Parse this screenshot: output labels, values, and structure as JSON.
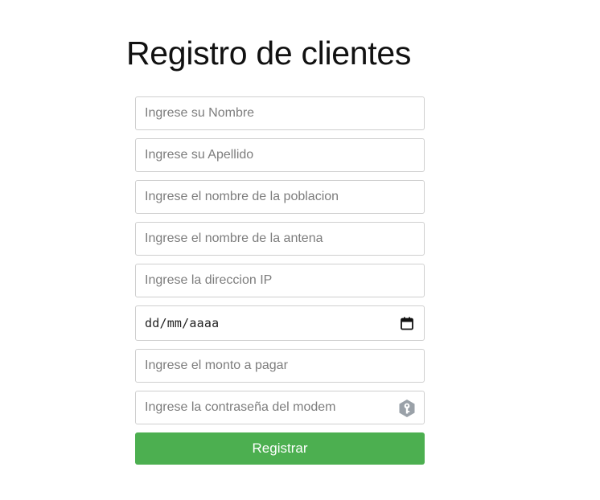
{
  "page": {
    "title": "Registro de clientes"
  },
  "form": {
    "nombre": {
      "placeholder": "Ingrese su Nombre",
      "value": ""
    },
    "apellido": {
      "placeholder": "Ingrese su Apellido",
      "value": ""
    },
    "poblacion": {
      "placeholder": "Ingrese el nombre de la poblacion",
      "value": ""
    },
    "antena": {
      "placeholder": "Ingrese el nombre de la antena",
      "value": ""
    },
    "ip": {
      "placeholder": "Ingrese la direccion IP",
      "value": ""
    },
    "fecha": {
      "display": "dd/mm/aaaa",
      "icon": "calendar-icon"
    },
    "monto": {
      "placeholder": "Ingrese el monto a pagar",
      "value": ""
    },
    "contrasena": {
      "placeholder": "Ingrese la contraseña del modem",
      "value": "",
      "icon": "key-icon"
    },
    "submit_label": "Registrar"
  },
  "colors": {
    "accent": "#4caf50",
    "border": "#cfcfcf",
    "placeholder": "#7d7d7d",
    "key_icon": "#9aa1a8"
  }
}
